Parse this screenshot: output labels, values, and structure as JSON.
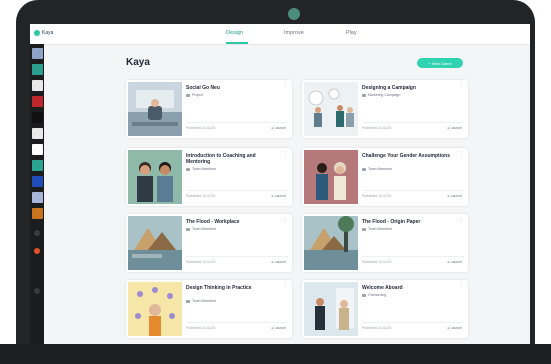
{
  "app": {
    "logo_text": "Kaya"
  },
  "nav": {
    "tabs": [
      {
        "label": "Design",
        "active": true
      },
      {
        "label": "Improve",
        "active": false
      },
      {
        "label": "Play",
        "active": false
      }
    ]
  },
  "page": {
    "title": "Kaya",
    "new_button_label": "+ New Game"
  },
  "sidebar": {
    "items": [
      {
        "color": "#8fa3c9"
      },
      {
        "color": "#2e9e8f"
      },
      {
        "color": "#e8e8e8"
      },
      {
        "color": "#c0272d"
      },
      {
        "color": "#111111"
      },
      {
        "color": "#e9e9e9"
      },
      {
        "color": "#ffffff"
      },
      {
        "color": "#2aa58f"
      },
      {
        "color": "#1e4cb8"
      },
      {
        "color": "#a7b6d8"
      },
      {
        "color": "#c9751e"
      }
    ],
    "bottom_dots": [
      {
        "color": "#3a3b3d"
      },
      {
        "color": "#e2512a"
      },
      {
        "color": "#3a3b3d"
      }
    ]
  },
  "cards": [
    {
      "title": "Social Go Neu",
      "meta": "Project",
      "footer_left": "Published 11/11/20",
      "footer_right": "Launch",
      "thumb": "office"
    },
    {
      "title": "Designing a Campaign",
      "meta": "Marketing Campaign",
      "footer_left": "Published 11/11/20",
      "footer_right": "Launch",
      "thumb": "meeting"
    },
    {
      "title": "Introduction to Coaching and Mentoring",
      "meta": "Team Members",
      "footer_left": "Published 11/11/20",
      "footer_right": "Launch",
      "thumb": "coaching"
    },
    {
      "title": "Challenge Your Gender Assumptions",
      "meta": "Team Members",
      "footer_left": "Published 11/11/20",
      "footer_right": "Launch",
      "thumb": "gender"
    },
    {
      "title": "The Flood - Workplace",
      "meta": "Team Members",
      "footer_left": "Published 11/11/20",
      "footer_right": "Launch",
      "thumb": "flood"
    },
    {
      "title": "The Flood - Origin Paper",
      "meta": "Team Members",
      "footer_left": "Published 11/11/20",
      "footer_right": "Launch",
      "thumb": "flood2"
    },
    {
      "title": "Design Thinking in Practice",
      "meta": "Team Members",
      "footer_left": "Published 11/11/20",
      "footer_right": "Launch",
      "thumb": "thinking"
    },
    {
      "title": "Welcome Aboard",
      "meta": "Onboarding",
      "footer_left": "Published 11/11/20",
      "footer_right": "Launch",
      "thumb": "welcome"
    }
  ],
  "colors": {
    "accent": "#2fd3b2",
    "accent_dark": "#1fa488",
    "sidebar_bg": "#1b1c1e",
    "laptop_body": "#232425"
  }
}
